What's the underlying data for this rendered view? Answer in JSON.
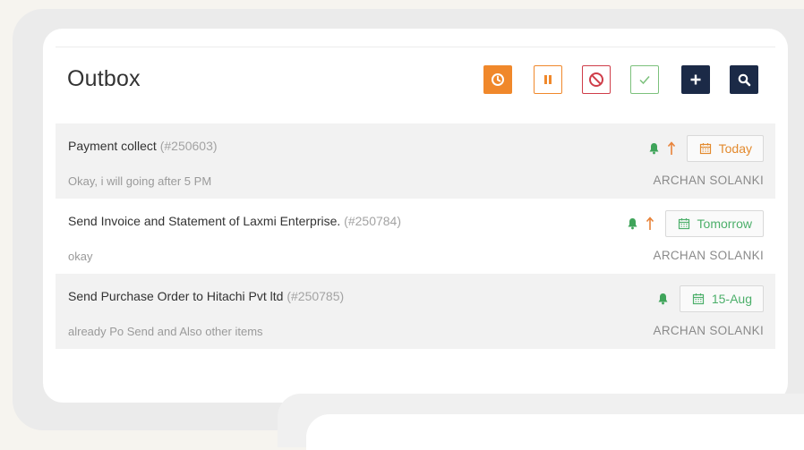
{
  "outbox": {
    "title": "Outbox",
    "toolbar": [
      {
        "name": "clock-filter-button",
        "icon": "clock-icon",
        "bg": "#f0882b",
        "border": "#f0882b",
        "fg": "#ffffff"
      },
      {
        "name": "pause-filter-button",
        "icon": "pause-icon",
        "bg": "#ffffff",
        "border": "#f0882b",
        "fg": "#f0882b"
      },
      {
        "name": "cancel-filter-button",
        "icon": "ban-icon",
        "bg": "#ffffff",
        "border": "#cf3d49",
        "fg": "#cf3d49"
      },
      {
        "name": "done-filter-button",
        "icon": "check-icon",
        "bg": "#ffffff",
        "border": "#7cc17c",
        "fg": "#7cc17c"
      },
      {
        "name": "add-task-button",
        "icon": "plus-icon",
        "bg": "#1b2a47",
        "border": "#1b2a47",
        "fg": "#ffffff"
      },
      {
        "name": "search-button",
        "icon": "search-icon",
        "bg": "#1b2a47",
        "border": "#1b2a47",
        "fg": "#ffffff"
      }
    ],
    "rows": [
      {
        "title": "Payment collect",
        "id": "(#250603)",
        "comment": "Okay, i will going after 5 PM",
        "assignee": "ARCHAN SOLANKI",
        "due": "Today",
        "due_color": "#e38a2e",
        "has_bell": true,
        "has_arrow": true,
        "shaded": true
      },
      {
        "title": "Send Invoice and Statement of Laxmi Enterprise.",
        "id": "(#250784)",
        "comment": "okay",
        "assignee": "ARCHAN SOLANKI",
        "due": "Tomorrow",
        "due_color": "#4caf6a",
        "has_bell": true,
        "has_arrow": true,
        "shaded": false
      },
      {
        "title": "Send Purchase Order to Hitachi Pvt ltd",
        "id": "(#250785)",
        "comment": "already Po Send and Also other items",
        "assignee": "ARCHAN SOLANKI",
        "due": "15-Aug",
        "due_color": "#4caf6a",
        "has_bell": true,
        "has_arrow": false,
        "shaded": true
      }
    ],
    "colors": {
      "bell": "#3fa45a",
      "arrow": "#e8833a"
    }
  }
}
